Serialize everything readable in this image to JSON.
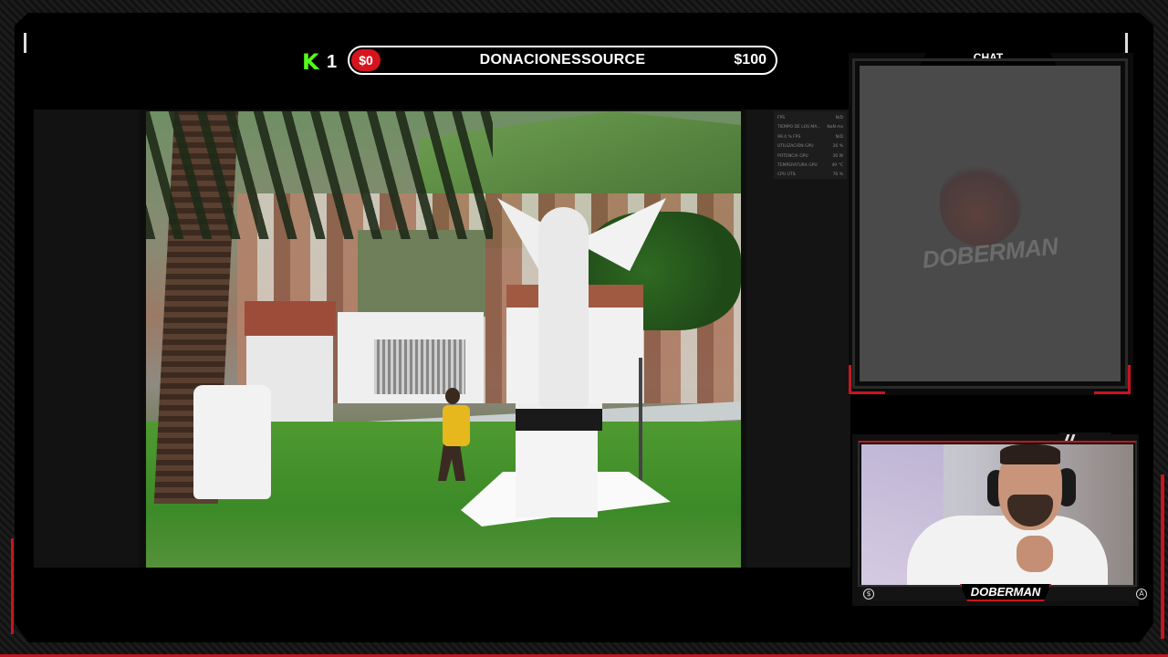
{
  "donation_bar": {
    "kick_logo": "K",
    "kick_count": "1",
    "current_amount": "$0",
    "title": "DONACIONESSOURCE",
    "goal_amount": "$100"
  },
  "perf_overlay": {
    "rows": [
      {
        "label": "FPS",
        "value": "N/D"
      },
      {
        "label": "TIEMPO DE LOS MA...",
        "value": "NaN ms"
      },
      {
        "label": "99.4 % FPS",
        "value": "N/D"
      },
      {
        "label": "UTILIZACIÓN GPU",
        "value": "26 %"
      },
      {
        "label": "POTENCIA GPU",
        "value": "36 W"
      },
      {
        "label": "TEMPERATURA GPU",
        "value": "49 °C"
      },
      {
        "label": "CPU UTIL",
        "value": "76 %"
      }
    ]
  },
  "chat": {
    "title": "CHAT",
    "watermark": "DOBERMAN"
  },
  "webcam": {
    "name": "DOBERMAN",
    "left_icon": "$",
    "right_icon": "A"
  },
  "colors": {
    "accent_red": "#c8141e",
    "kick_green": "#53fc18"
  }
}
